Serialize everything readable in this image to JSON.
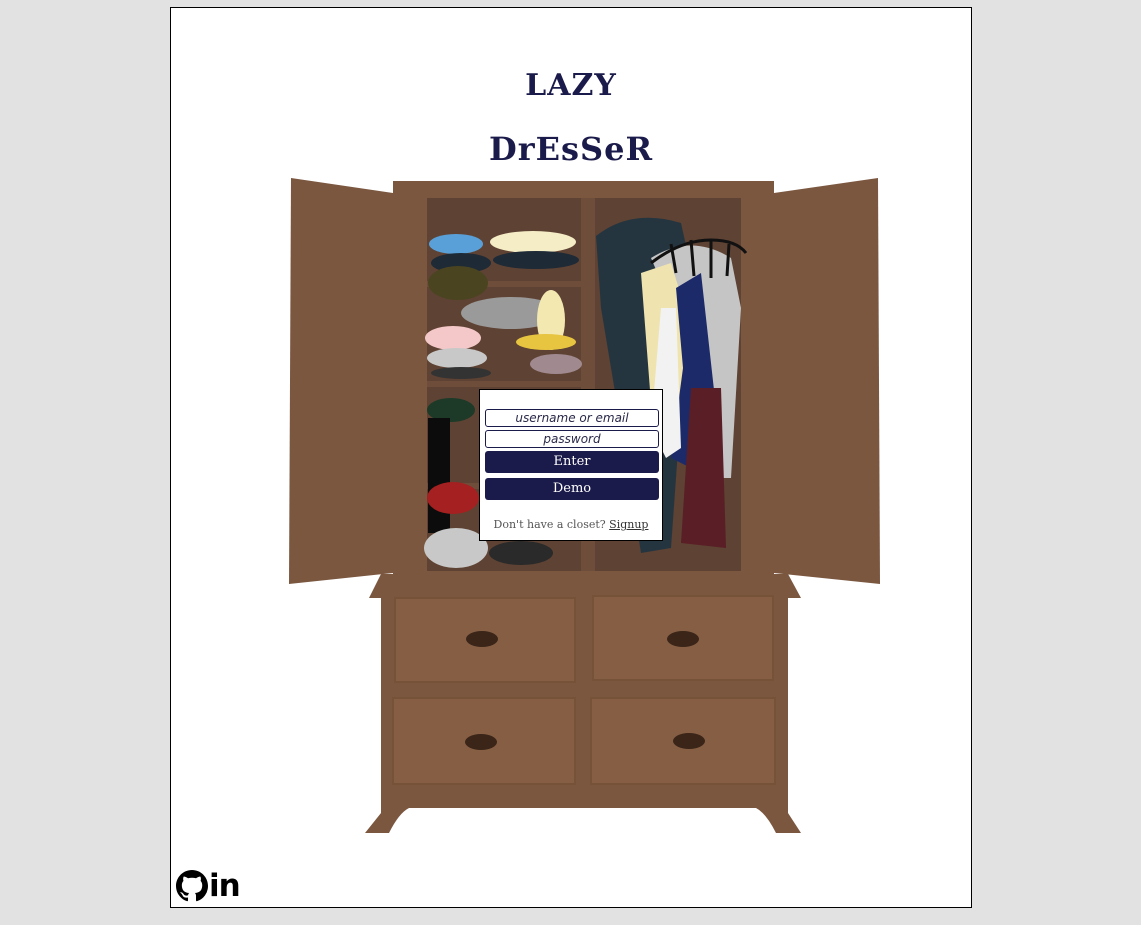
{
  "header": {
    "title_line1": "LAZY",
    "title_line2": "DrEsSeR"
  },
  "login": {
    "username_placeholder": "username or email",
    "password_placeholder": "password",
    "enter_label": "Enter",
    "demo_label": "Demo",
    "signup_prompt": "Don't have a closet? ",
    "signup_link": "Signup"
  },
  "footer": {
    "github_icon": "github-icon",
    "linkedin_label": "in"
  },
  "colors": {
    "brand": "#1b1b4b",
    "wood": "#7b5740",
    "page_bg": "#e2e2e2"
  }
}
